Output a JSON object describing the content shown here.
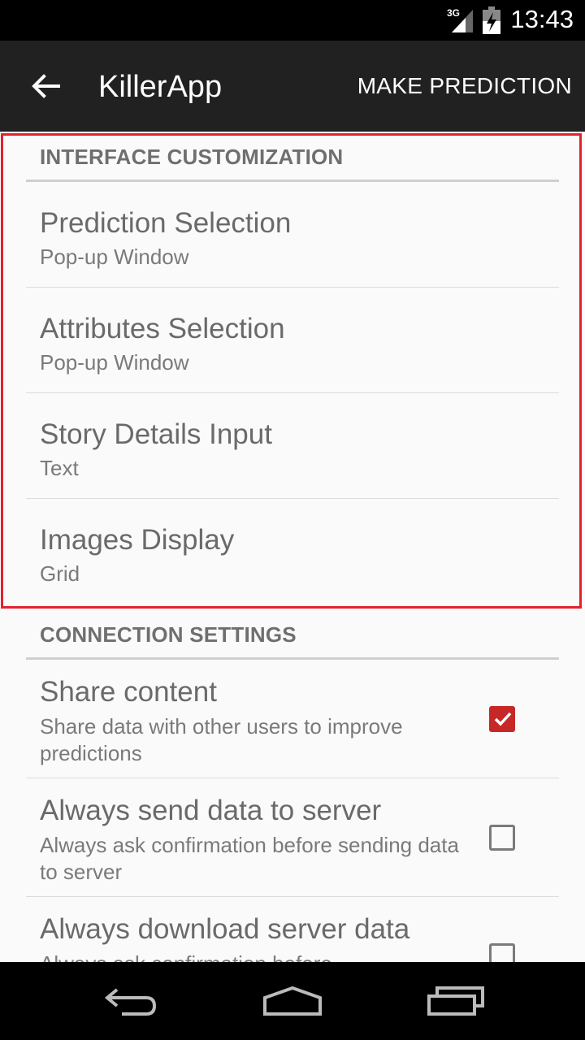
{
  "status_bar": {
    "network": "3G",
    "time": "13:43"
  },
  "action_bar": {
    "title": "KillerApp",
    "action": "MAKE PREDICTION",
    "back_icon": "arrow-back-icon"
  },
  "sections": [
    {
      "header": "INTERFACE CUSTOMIZATION",
      "items": [
        {
          "title": "Prediction Selection",
          "summary": "Pop-up Window"
        },
        {
          "title": "Attributes Selection",
          "summary": "Pop-up Window"
        },
        {
          "title": "Story Details Input",
          "summary": "Text"
        },
        {
          "title": "Images Display",
          "summary": "Grid"
        }
      ]
    },
    {
      "header": "CONNECTION SETTINGS",
      "items": [
        {
          "title": "Share content",
          "summary": "Share data with other users to improve predictions",
          "checked": true
        },
        {
          "title": "Always send data to server",
          "summary": "Always ask confirmation before sending data to server",
          "checked": false
        },
        {
          "title": "Always download server data",
          "summary": "Always ask confirmation before",
          "checked": false
        }
      ]
    }
  ],
  "nav_bar": {
    "back": "back-icon",
    "home": "home-icon",
    "recents": "recents-icon"
  },
  "colors": {
    "accent": "#c62828",
    "action_bar": "#212121",
    "highlight": "#e3222e"
  }
}
